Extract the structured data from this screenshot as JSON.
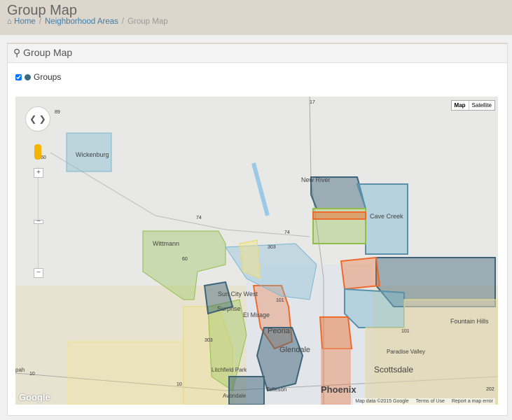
{
  "header": {
    "title": "Group Map",
    "breadcrumb": [
      {
        "label": "Home",
        "icon": "home-icon"
      },
      {
        "label": "Neighborhood Areas"
      },
      {
        "label": "Group Map"
      }
    ]
  },
  "panel": {
    "title": "Group Map",
    "icon": "map-marker-icon"
  },
  "legend": {
    "label": "Groups",
    "checked": true,
    "color": "#3a6b80"
  },
  "map": {
    "type_buttons": [
      "Map",
      "Satellite"
    ],
    "active_type": "Map",
    "attribution": {
      "data": "Map data ©2015 Google",
      "terms": "Terms of Use",
      "report": "Report a map error"
    },
    "logo": "Google",
    "places": [
      "Wickenburg",
      "New River",
      "Cave Creek",
      "Wittmann",
      "Sun City West",
      "Surprise",
      "El Mirage",
      "Peoria",
      "Glendale",
      "Fountain Hills",
      "Paradise Valley",
      "Scottsdale",
      "Litchfield Park",
      "Tolleson",
      "Phoenix",
      "Avondale",
      "pah"
    ],
    "highways": [
      "89",
      "60",
      "17",
      "74",
      "74",
      "303",
      "60",
      "101",
      "101",
      "10",
      "10",
      "202",
      "303"
    ],
    "colors": {
      "blue": "#7ab8d0",
      "slate": "#3d6478",
      "green": "#8fbf4a",
      "orange": "#ec6a2c",
      "yellow": "#f1e38a"
    }
  }
}
